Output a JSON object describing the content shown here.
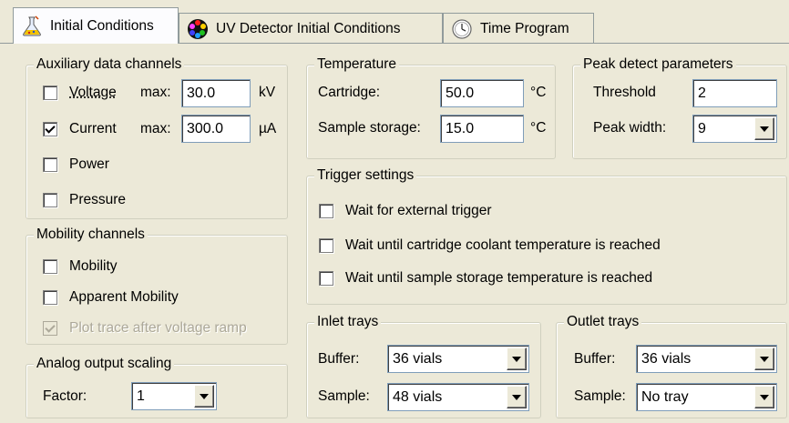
{
  "tabs": [
    {
      "label": "Initial Conditions",
      "icon": "flask-icon",
      "active": true
    },
    {
      "label": "UV Detector Initial Conditions",
      "icon": "color-wheel-icon",
      "active": false
    },
    {
      "label": "Time Program",
      "icon": "clock-icon",
      "active": false
    }
  ],
  "aux": {
    "title": "Auxiliary data channels",
    "voltage": {
      "label": "Voltage",
      "checked": false,
      "max_label": "max:",
      "value": "30.0",
      "unit": "kV"
    },
    "current": {
      "label": "Current",
      "checked": true,
      "max_label": "max:",
      "value": "300.0",
      "unit": "µA"
    },
    "power": {
      "label": "Power",
      "checked": false
    },
    "pressure": {
      "label": "Pressure",
      "checked": false
    }
  },
  "mobility": {
    "title": "Mobility channels",
    "mobility": {
      "label": "Mobility",
      "checked": false
    },
    "apparent": {
      "label": "Apparent Mobility",
      "checked": false
    },
    "plot_trace": {
      "label": "Plot trace after voltage ramp",
      "checked": true,
      "disabled": true
    }
  },
  "analog": {
    "title": "Analog output scaling",
    "factor_label": "Factor:",
    "factor_value": "1"
  },
  "temperature": {
    "title": "Temperature",
    "cartridge_label": "Cartridge:",
    "cartridge_value": "50.0",
    "cartridge_unit": "°C",
    "storage_label": "Sample storage:",
    "storage_value": "15.0",
    "storage_unit": "°C"
  },
  "peak": {
    "title": "Peak detect parameters",
    "threshold_label": "Threshold",
    "threshold_value": "2",
    "width_label": "Peak width:",
    "width_value": "9"
  },
  "trigger": {
    "title": "Trigger settings",
    "external": {
      "label": "Wait for external trigger",
      "checked": false
    },
    "coolant": {
      "label": "Wait until cartridge coolant temperature is reached",
      "checked": false
    },
    "storage": {
      "label": "Wait until sample storage temperature is reached",
      "checked": false
    }
  },
  "inlet": {
    "title": "Inlet trays",
    "buffer_label": "Buffer:",
    "buffer_value": "36 vials",
    "sample_label": "Sample:",
    "sample_value": "48 vials"
  },
  "outlet": {
    "title": "Outlet trays",
    "buffer_label": "Buffer:",
    "buffer_value": "36 vials",
    "sample_label": "Sample:",
    "sample_value": "No tray"
  }
}
